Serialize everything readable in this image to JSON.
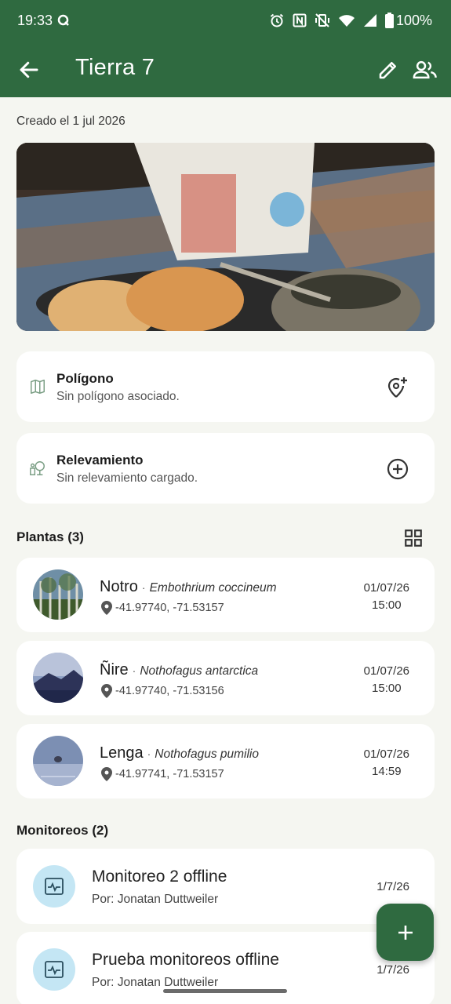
{
  "status_bar": {
    "time": "19:33",
    "battery": "100%",
    "icons": [
      "app-notification-icon",
      "alarm-icon",
      "nfc-icon",
      "vibrate-off-icon",
      "wifi-icon",
      "signal-icon",
      "battery-icon"
    ]
  },
  "app_bar": {
    "title": "Tierra 7",
    "icons": [
      "back-arrow-icon",
      "edit-icon",
      "people-icon"
    ],
    "color": "#2f6a40"
  },
  "created_label": "Creado el 1 jul 2026",
  "polygon": {
    "title": "Polígono",
    "subtitle": "Sin polígono asociado.",
    "icons": [
      "map-icon",
      "add-location-icon"
    ]
  },
  "survey": {
    "title": "Relevamiento",
    "subtitle": "Sin relevamiento cargado.",
    "icons": [
      "survey-icon",
      "add-circle-icon"
    ]
  },
  "plants": {
    "header": "Plantas (3)",
    "items": [
      {
        "name": "Notro",
        "scientific": "Embothrium coccineum",
        "coords": "-41.97740, -71.53157",
        "date": "01/07/26",
        "time": "15:00"
      },
      {
        "name": "Ñire",
        "scientific": "Nothofagus antarctica",
        "coords": "-41.97740, -71.53156",
        "date": "01/07/26",
        "time": "15:00"
      },
      {
        "name": "Lenga",
        "scientific": "Nothofagus pumilio",
        "coords": "-41.97741, -71.53157",
        "date": "01/07/26",
        "time": "14:59"
      }
    ]
  },
  "monitoring": {
    "header": "Monitoreos (2)",
    "items": [
      {
        "title": "Monitoreo 2 offline",
        "author": "Por: Jonatan Duttweiler",
        "date": "1/7/26"
      },
      {
        "title": "Prueba monitoreos offline",
        "author": "Por: Jonatan Duttweiler",
        "date": "1/7/26"
      }
    ]
  },
  "fab_icon": "add-icon",
  "colors": {
    "primary": "#2f6a40",
    "background": "#f5f6f1",
    "monitor_circle": "#c4e6f4"
  }
}
